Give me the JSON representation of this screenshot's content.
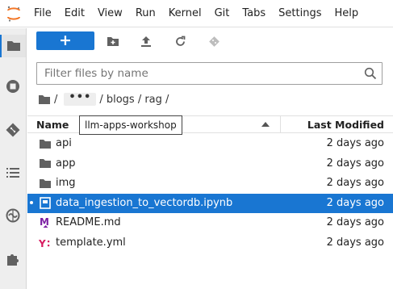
{
  "menu": [
    "File",
    "Edit",
    "View",
    "Run",
    "Kernel",
    "Git",
    "Tabs",
    "Settings",
    "Help"
  ],
  "toolbar": {
    "new_label": "+"
  },
  "filter": {
    "placeholder": "Filter files by name"
  },
  "breadcrumb": {
    "ellipsis": "•••",
    "parts": [
      "/",
      "/ blogs / rag /"
    ]
  },
  "list": {
    "name_header": "Name",
    "modified_header": "Last Modified",
    "tooltip": "llm-apps-workshop",
    "files": [
      {
        "name": "api",
        "modified": "2 days ago",
        "kind": "folder"
      },
      {
        "name": "app",
        "modified": "2 days ago",
        "kind": "folder"
      },
      {
        "name": "img",
        "modified": "2 days ago",
        "kind": "folder"
      },
      {
        "name": "data_ingestion_to_vectordb.ipynb",
        "modified": "2 days ago",
        "kind": "notebook",
        "selected": true
      },
      {
        "name": "README.md",
        "modified": "2 days ago",
        "kind": "markdown"
      },
      {
        "name": "template.yml",
        "modified": "2 days ago",
        "kind": "yaml"
      }
    ]
  },
  "colors": {
    "accent": "#1976d2",
    "jupyter_orange": "#f37626",
    "markdown_purple": "#7b1fa2",
    "yaml_magenta": "#d81b60"
  },
  "icons": {
    "activity": [
      "folder-icon",
      "running-icon",
      "git-icon",
      "toc-icon",
      "extension-manager-icon",
      "puzzle-icon"
    ],
    "toolbar": [
      "new-folder-icon",
      "upload-icon",
      "refresh-icon",
      "git-clone-icon"
    ]
  }
}
